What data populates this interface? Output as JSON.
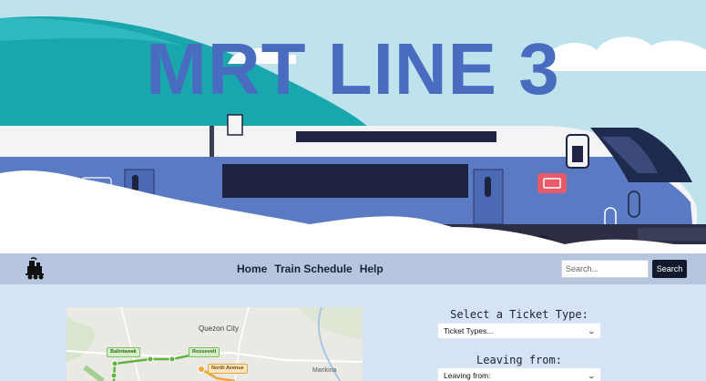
{
  "hero": {
    "title": "MRT LINE 3"
  },
  "navbar": {
    "logo_icon": "train-icon",
    "links": [
      {
        "label": "Home"
      },
      {
        "label": "Train Schedule"
      },
      {
        "label": "Help"
      }
    ],
    "search": {
      "placeholder": "Search...",
      "button_label": "Search"
    }
  },
  "map": {
    "city_label": "Quezon City",
    "area_label": "Marikina",
    "stations": [
      "Balintawak",
      "Roosevelt",
      "North Avenue"
    ]
  },
  "form": {
    "ticket_type": {
      "heading": "Select a Ticket Type:",
      "selected": "Ticket Types...",
      "icon": "chevron-down-icon"
    },
    "leaving_from": {
      "heading": "Leaving from:",
      "selected": "Leaving from:",
      "icon": "chevron-down-icon"
    }
  },
  "colors": {
    "title": "#4a6cc0",
    "train_body": "#5a7ac4",
    "navbar": "#b6c6df",
    "page": "#d6e3f6",
    "search_button": "#101a2c",
    "green_line": "#5fb33f",
    "orange_line": "#f0a53a"
  }
}
